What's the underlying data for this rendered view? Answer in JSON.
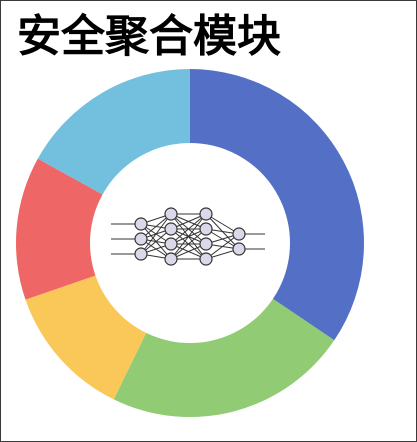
{
  "title": "安全聚合模块",
  "segments": [
    {
      "color": "#5470c6"
    },
    {
      "color": "#91cc75"
    },
    {
      "color": "#fac858"
    },
    {
      "color": "#ee6666"
    },
    {
      "color": "#73c0de"
    }
  ],
  "center_icon": "neural-network-icon"
}
